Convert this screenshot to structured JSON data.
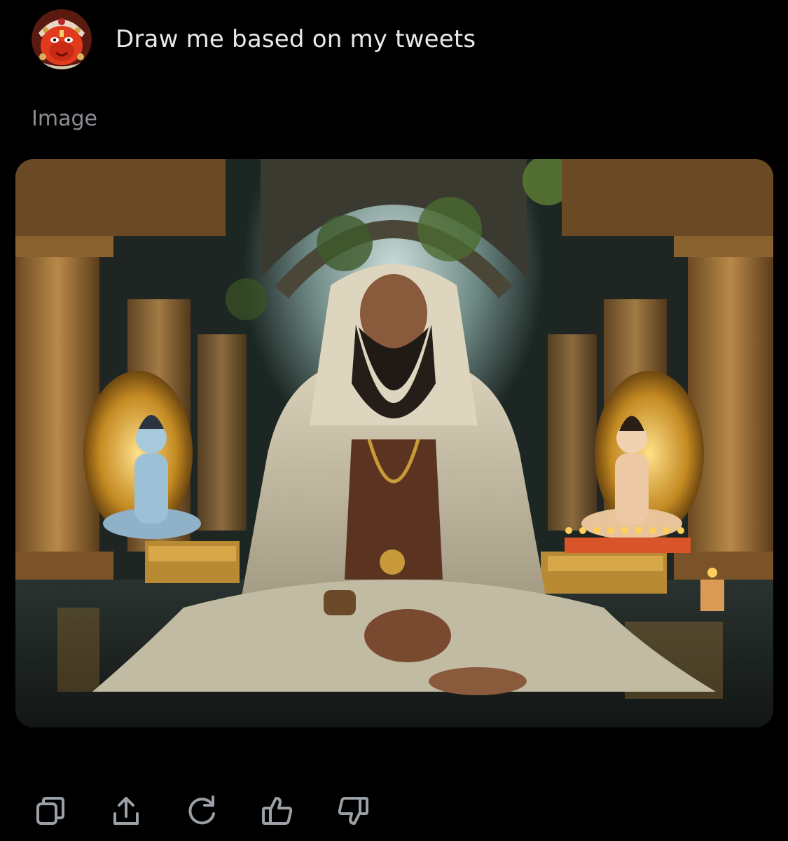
{
  "prompt": {
    "text": "Draw me based on my tweets",
    "avatar_icon": "red-deity-face-avatar"
  },
  "response": {
    "label": "Image",
    "image_subject": "meditating-bearded-sage-in-temple"
  },
  "actions": [
    {
      "name": "copy",
      "icon": "copy-icon"
    },
    {
      "name": "share",
      "icon": "share-icon"
    },
    {
      "name": "regenerate",
      "icon": "regenerate-icon"
    },
    {
      "name": "like",
      "icon": "thumbs-up-icon"
    },
    {
      "name": "dislike",
      "icon": "thumbs-down-icon"
    }
  ],
  "colors": {
    "background": "#000000",
    "text": "#e7e9ea",
    "muted": "#8b8f94",
    "icon": "#9aa0a6"
  }
}
